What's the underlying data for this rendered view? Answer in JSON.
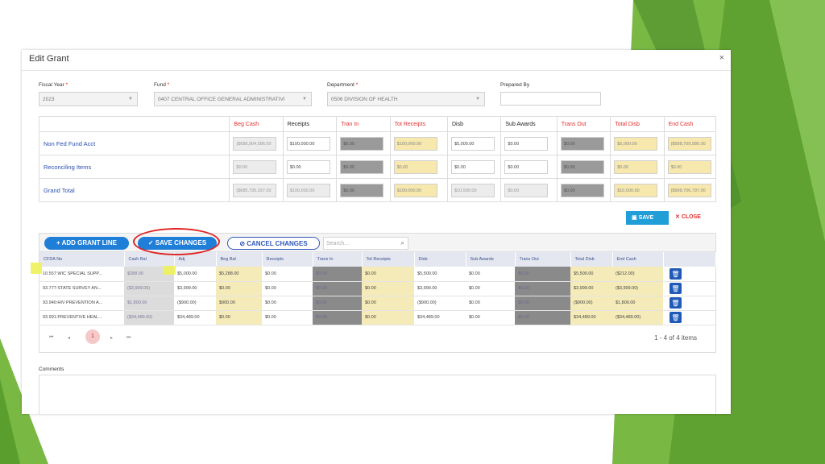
{
  "dialog": {
    "title": "Edit Grant",
    "close": "×"
  },
  "fields": {
    "fiscal_year": {
      "label": "Fiscal Year",
      "value": "2023"
    },
    "fund": {
      "label": "Fund",
      "value": "0407 CENTRAL OFFICE GENERAL ADMINISTRATIVI"
    },
    "department": {
      "label": "Department",
      "value": "0506 DIVISION OF HEALTH"
    },
    "prepared_by": {
      "label": "Prepared By",
      "value": ""
    },
    "required_mark": "*"
  },
  "summary": {
    "headers": [
      "Beg Cash",
      "Receipts",
      "Tran In",
      "Tot Receipts",
      "Disb",
      "Sub Awards",
      "Trans Out",
      "Total Disb",
      "End Cash"
    ],
    "rows": [
      {
        "label": "Non Fed Fund Acct",
        "cells": [
          "($688,904,586.00",
          "$100,000.00",
          "$0.00",
          "$100,000.00",
          "$5,000.00",
          "$0.00",
          "$0.00",
          "$5,000.00",
          "($688,709,986.00"
        ]
      },
      {
        "label": "Reconciling Items",
        "cells": [
          "$0.00",
          "$0.00",
          "$0.00",
          "$0.00",
          "$0.00",
          "$0.00",
          "$0.00",
          "$0.00",
          "$0.00"
        ]
      },
      {
        "label": "Grand Total",
        "cells": [
          "($685,795,297.00",
          "$100,000.00",
          "$0.00",
          "$100,000.00",
          "$10,500.00",
          "$0.00",
          "$0.00",
          "$10,500.00",
          "($688,706,797.00"
        ]
      }
    ]
  },
  "actions": {
    "save": "SAVE",
    "close": "CLOSE"
  },
  "grid": {
    "add_button": "ADD GRANT LINE",
    "save_changes": "SAVE CHANGES",
    "cancel_changes": "CANCEL CHANGES",
    "search_placeholder": "Search...",
    "headers": [
      "CFDA No",
      "Cash Bal",
      "Adj",
      "Beg Bal",
      "Receipts",
      "Trans In",
      "Tot Receipts",
      "Disb",
      "Sub Awards",
      "Trans Out",
      "Total Disb",
      "End Cash"
    ],
    "rows": [
      [
        "10.557:WIC SPECIAL SUPP...",
        "$288.00",
        "$5,000.00",
        "$5,288.00",
        "$0.00",
        "$0.00",
        "$0.00",
        "$5,500.00",
        "$0.00",
        "$0.00",
        "$5,500.00",
        "($212.00)"
      ],
      [
        "93.777:STATE SURVEY AN...",
        "($3,999.00)",
        "$3,999.00",
        "$0.00",
        "$0.00",
        "$0.00",
        "$0.00",
        "$3,999.00",
        "$0.00",
        "$0.00",
        "$3,999.00",
        "($3,999.00)"
      ],
      [
        "93.940:HIV PREVENTION A...",
        "$1,800.00",
        "($900.00)",
        "$900.00",
        "$0.00",
        "$0.00",
        "$0.00",
        "($900.00)",
        "$0.00",
        "$0.00",
        "($900.00)",
        "$1,800.00"
      ],
      [
        "93.991:PREVENTIVE HEAL...",
        "($34,489.00)",
        "$34,489.00",
        "$0.00",
        "$0.00",
        "$0.00",
        "$0.00",
        "$34,489.00",
        "$0.00",
        "$0.00",
        "$34,489.00",
        "($34,489.00)"
      ]
    ],
    "pager": {
      "first": "⏮",
      "prev": "◂",
      "current": "1",
      "next": "▸",
      "last": "⏭",
      "info": "1 - 4 of 4 items"
    }
  },
  "comments_label": "Comments",
  "colors": {
    "accent_blue": "#1f7ed8",
    "red": "#e03030",
    "highlight": "#eef25a"
  }
}
